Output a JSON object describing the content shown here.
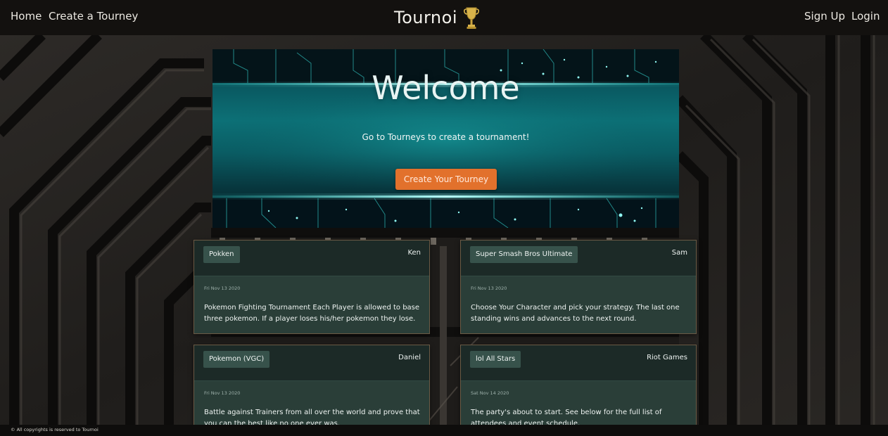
{
  "nav": {
    "home": "Home",
    "create": "Create a Tourney",
    "brand": "Tournoi",
    "signup": "Sign Up",
    "login": "Login"
  },
  "hero": {
    "title": "Welcome",
    "subtitle": "Go to Tourneys to create a tournament!",
    "button": "Create Your Tourney"
  },
  "cards": [
    {
      "game": "Pokken",
      "owner": "Ken",
      "date": "Fri Nov 13 2020",
      "description": "Pokemon Fighting Tournament Each Player is allowed to base three pokemon. If a player loses his/her pokemon they lose."
    },
    {
      "game": "Super Smash Bros Ultimate",
      "owner": "Sam",
      "date": "Fri Nov 13 2020",
      "description": "Choose Your Character and pick your strategy. The last one standing wins and advances to the next round."
    },
    {
      "game": "Pokemon (VGC)",
      "owner": "Daniel",
      "date": "Fri Nov 13 2020",
      "description": "Battle against Trainers from all over the world and prove that you can the best like no one ever was."
    },
    {
      "game": "lol All Stars",
      "owner": "Riot Games",
      "date": "Sat Nov 14 2020",
      "description": "The party's about to start. See below for the full list of attendees and event schedule."
    }
  ],
  "footer": {
    "text": "© All copyrights is reserved to Tournoi"
  },
  "colors": {
    "accent": "#e2712c",
    "navbar": "#13110f",
    "card_body": "#2a3e38",
    "card_header": "#1c2a27",
    "hero_glow": "#5ff0ea"
  },
  "icons": {
    "brand_icon": "trophy-icon"
  }
}
